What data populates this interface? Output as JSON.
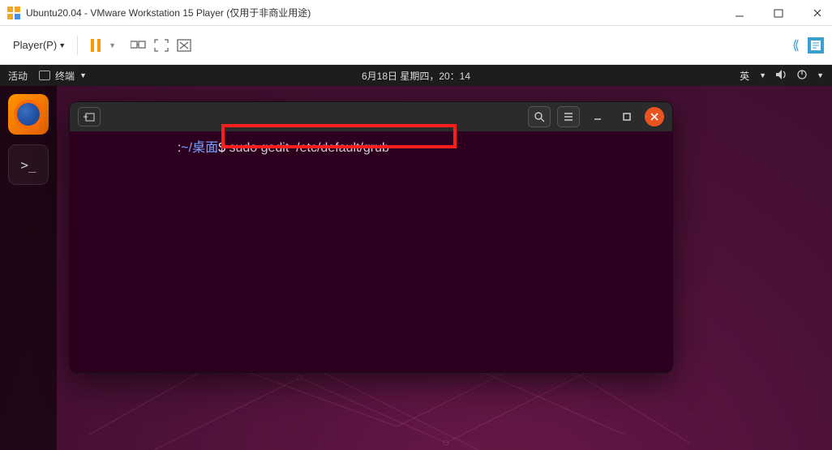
{
  "vmware": {
    "title": "Ubuntu20.04 - VMware Workstation 15 Player (仅用于非商业用途)",
    "player_menu": "Player(P)"
  },
  "ubuntu": {
    "activities": "活动",
    "app_menu": "终端",
    "datetime": "6月18日 星期四，20：14",
    "input_method": "英"
  },
  "terminal": {
    "prompt_user": "",
    "prompt_sep": ":",
    "prompt_path": "~/桌面",
    "prompt_symbol": "$",
    "command": "sudo gedit  /etc/default/grub"
  }
}
